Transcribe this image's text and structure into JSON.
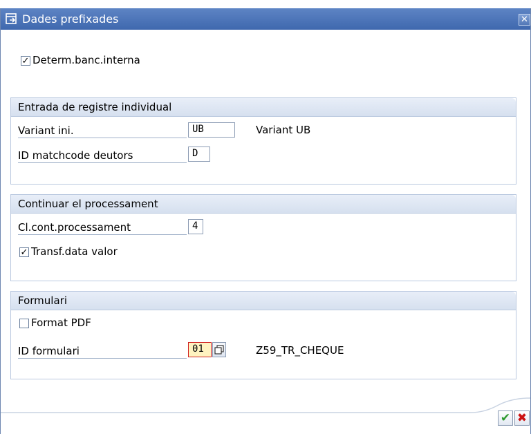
{
  "dialog": {
    "title": "Dades prefixades",
    "close_glyph": "✕"
  },
  "top": {
    "determ_checked": true,
    "determ_label": "Determ.banc.interna"
  },
  "group1": {
    "title": "Entrada de registre individual",
    "variant_label": "Variant ini.",
    "variant_value": "UB",
    "variant_text": "Variant UB",
    "matchcode_label": "ID matchcode deutors",
    "matchcode_value": "D"
  },
  "group2": {
    "title": "Continuar el processament",
    "cl_label": "Cl.cont.processament",
    "cl_value": "4",
    "transf_checked": true,
    "transf_label": "Transf.data valor"
  },
  "group3": {
    "title": "Formulari",
    "pdf_checked": false,
    "pdf_label": "Format PDF",
    "form_label": "ID formulari",
    "form_value": "01",
    "form_text": "Z59_TR_CHEQUE"
  },
  "buttons": {
    "ok_glyph": "✔",
    "cancel_glyph": "✖"
  },
  "colors": {
    "titlebar": "#4a72b8",
    "ok": "#2e9a2e",
    "cancel": "#cc1111"
  }
}
